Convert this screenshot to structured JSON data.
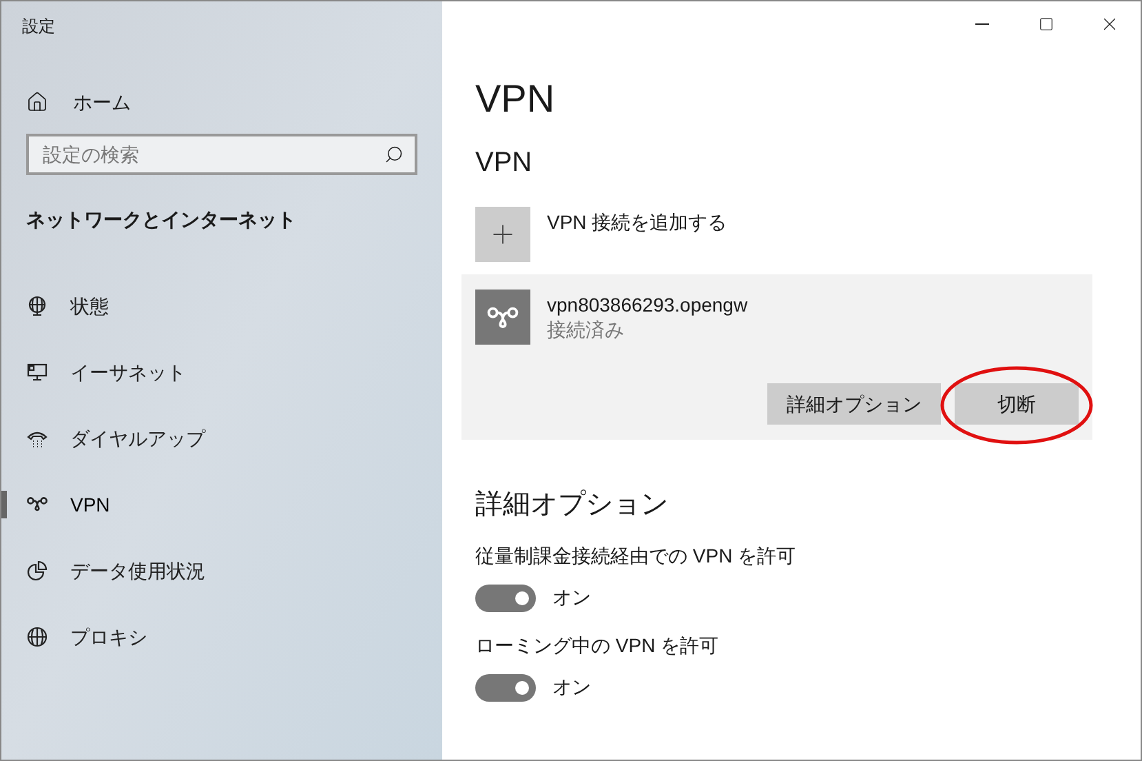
{
  "window": {
    "title": "設定"
  },
  "sidebar": {
    "home": "ホーム",
    "search": {
      "placeholder": "設定の検索"
    },
    "category": "ネットワークとインターネット",
    "items": [
      {
        "label": "状態",
        "kind": "status",
        "selected": false
      },
      {
        "label": "イーサネット",
        "kind": "ethernet",
        "selected": false
      },
      {
        "label": "ダイヤルアップ",
        "kind": "dialup",
        "selected": false
      },
      {
        "label": "VPN",
        "kind": "vpn",
        "selected": true
      },
      {
        "label": "データ使用状況",
        "kind": "data",
        "selected": false
      },
      {
        "label": "プロキシ",
        "kind": "proxy",
        "selected": false
      }
    ]
  },
  "page": {
    "title": "VPN",
    "section": "VPN",
    "add_label": "VPN 接続を追加する",
    "connection": {
      "name": "vpn803866293.opengw",
      "status": "接続済み",
      "buttons": [
        {
          "label": "詳細オプション",
          "annotated": false
        },
        {
          "label": "切断",
          "annotated": true
        }
      ]
    },
    "advanced_title": "詳細オプション",
    "settings": [
      {
        "label": "従量制課金接続経由での VPN を許可",
        "on": true,
        "state": "オン"
      },
      {
        "label": "ローミング中の VPN を許可",
        "on": true,
        "state": "オン"
      }
    ]
  }
}
